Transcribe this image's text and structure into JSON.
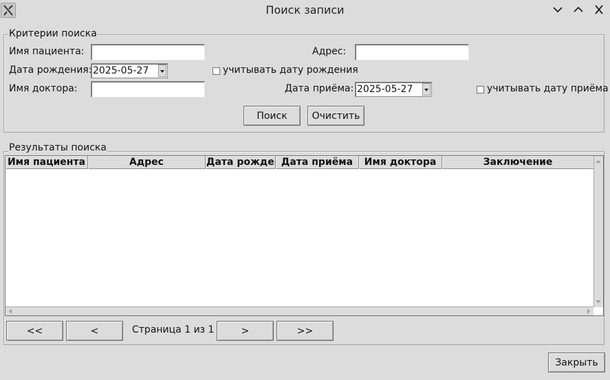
{
  "window": {
    "title": "Поиск записи"
  },
  "criteria": {
    "legend": "Критерии поиска",
    "patient_name_label": "Имя пациента:",
    "patient_name_value": "",
    "address_label": "Адрес:",
    "address_value": "",
    "birth_date_label": "Дата рождения:",
    "birth_date_value": "2025-05-27",
    "use_birth_date_label": "учитывать дату рождения",
    "use_birth_date_checked": false,
    "doctor_name_label": "Имя доктора:",
    "doctor_name_value": "",
    "visit_date_label": "Дата приёма:",
    "visit_date_value": "2025-05-27",
    "use_visit_date_label": "учитывать дату приёма",
    "use_visit_date_checked": false,
    "search_button": "Поиск",
    "clear_button": "Очистить"
  },
  "results": {
    "legend": "Результаты поиска",
    "columns": [
      "Имя пациента",
      "Адрес",
      "Дата рождения",
      "Дата приёма",
      "Имя доктора",
      "Заключение"
    ],
    "rows": []
  },
  "pagination": {
    "first": "<<",
    "prev": "<",
    "page_text": "Страница 1 из 1",
    "next": ">",
    "last": ">>"
  },
  "footer": {
    "close_button": "Закрыть"
  }
}
